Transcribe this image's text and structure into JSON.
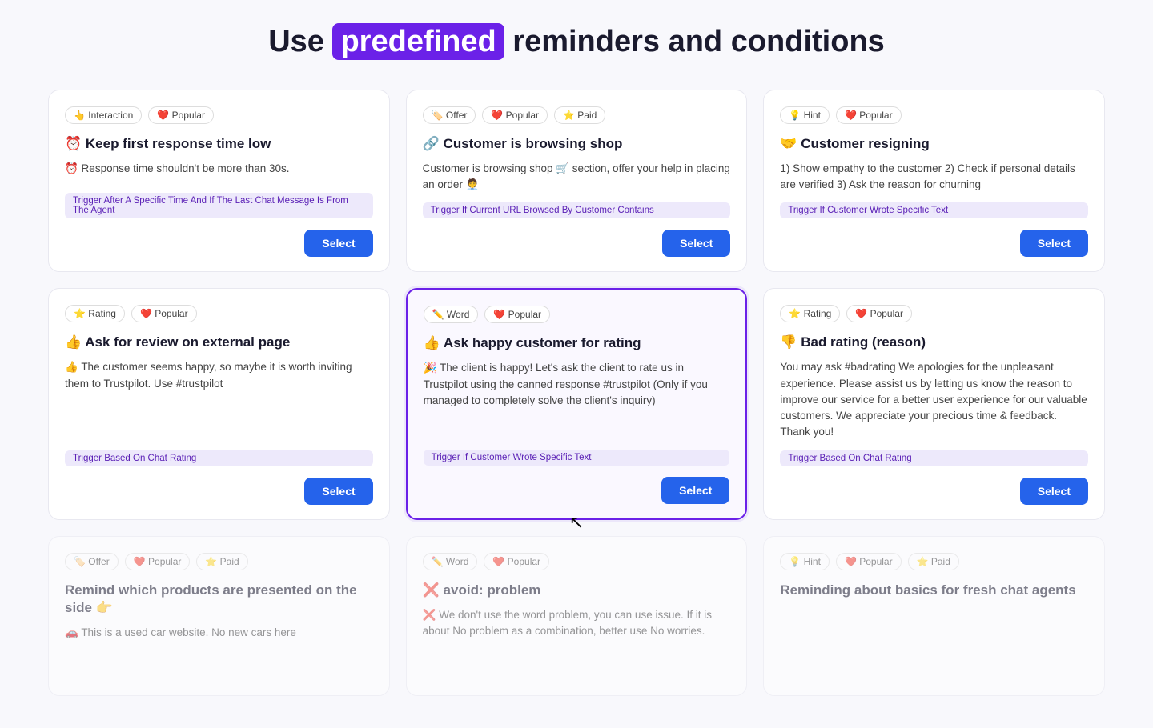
{
  "header": {
    "title_prefix": "Use ",
    "title_highlight": "predefined",
    "title_suffix": " reminders and conditions"
  },
  "cards": [
    {
      "id": "keep-response-time",
      "tags": [
        {
          "icon": "👆",
          "label": "Interaction"
        },
        {
          "icon": "❤️",
          "label": "Popular"
        }
      ],
      "title": "⏰ Keep first response time low",
      "desc": "⏰ Response time shouldn't be more than 30s.",
      "trigger": "Trigger After A Specific Time And If The Last Chat Message Is From The Agent",
      "has_select": true,
      "highlighted": false,
      "dimmed": false
    },
    {
      "id": "customer-browsing",
      "tags": [
        {
          "icon": "🏷️",
          "label": "Offer"
        },
        {
          "icon": "❤️",
          "label": "Popular"
        },
        {
          "icon": "⭐",
          "label": "Paid"
        }
      ],
      "title": "🔗 Customer is browsing shop",
      "desc": "Customer is browsing shop 🛒 section, offer your help in placing an order 🧑‍💼",
      "trigger": "Trigger If Current URL Browsed By Customer Contains",
      "has_select": true,
      "highlighted": false,
      "dimmed": false
    },
    {
      "id": "customer-resigning",
      "tags": [
        {
          "icon": "💡",
          "label": "Hint"
        },
        {
          "icon": "❤️",
          "label": "Popular"
        }
      ],
      "title": "🤝 Customer resigning",
      "desc": "1) Show empathy to the customer 2) Check if personal details are verified 3) Ask the reason for churning",
      "trigger": "Trigger If Customer Wrote Specific Text",
      "has_select": true,
      "highlighted": false,
      "dimmed": false
    },
    {
      "id": "ask-review",
      "tags": [
        {
          "icon": "⭐",
          "label": "Rating"
        },
        {
          "icon": "❤️",
          "label": "Popular"
        }
      ],
      "title": "👍 Ask for review on external page",
      "desc": "👍 The customer seems happy, so maybe it is worth inviting them to Trustpilot. Use #trustpilot",
      "trigger": "Trigger Based On Chat Rating",
      "has_select": true,
      "highlighted": false,
      "dimmed": false
    },
    {
      "id": "ask-happy-rating",
      "tags": [
        {
          "icon": "✏️",
          "label": "Word"
        },
        {
          "icon": "❤️",
          "label": "Popular"
        }
      ],
      "title": "👍 Ask happy customer for rating",
      "desc": "🎉 The client is happy! Let's ask the client to rate us in Trustpilot using the canned response #trustpilot (Only if you managed to completely solve the client's inquiry)",
      "trigger": "Trigger If Customer Wrote Specific Text",
      "has_select": true,
      "highlighted": true,
      "dimmed": false
    },
    {
      "id": "bad-rating",
      "tags": [
        {
          "icon": "⭐",
          "label": "Rating"
        },
        {
          "icon": "❤️",
          "label": "Popular"
        }
      ],
      "title": "👎 Bad rating (reason)",
      "desc": "You may ask #badrating We apologies for the unpleasant experience. Please assist us by letting us know the reason to improve our service for a better user experience for our valuable customers. We appreciate your precious time & feedback. Thank you!",
      "trigger": "Trigger Based On Chat Rating",
      "has_select": true,
      "highlighted": false,
      "dimmed": false
    },
    {
      "id": "remind-products",
      "tags": [
        {
          "icon": "🏷️",
          "label": "Offer"
        },
        {
          "icon": "❤️",
          "label": "Popular"
        },
        {
          "icon": "⭐",
          "label": "Paid"
        }
      ],
      "title": "Remind which products are presented on the side 👉",
      "desc": "🚗 This is a used car website. No new cars here",
      "trigger": null,
      "has_select": false,
      "highlighted": false,
      "dimmed": true
    },
    {
      "id": "avoid-problem",
      "tags": [
        {
          "icon": "✏️",
          "label": "Word"
        },
        {
          "icon": "❤️",
          "label": "Popular"
        }
      ],
      "title": "❌ avoid: problem",
      "desc": "❌ We don't use the word problem, you can use issue. If it is about No problem as a combination, better use No worries.",
      "trigger": null,
      "has_select": false,
      "highlighted": false,
      "dimmed": true
    },
    {
      "id": "reminding-basics",
      "tags": [
        {
          "icon": "💡",
          "label": "Hint"
        },
        {
          "icon": "❤️",
          "label": "Popular"
        },
        {
          "icon": "⭐",
          "label": "Paid"
        }
      ],
      "title": "Reminding about basics for fresh chat agents",
      "desc": "",
      "trigger": null,
      "has_select": false,
      "highlighted": false,
      "dimmed": true
    }
  ],
  "select_label": "Select"
}
